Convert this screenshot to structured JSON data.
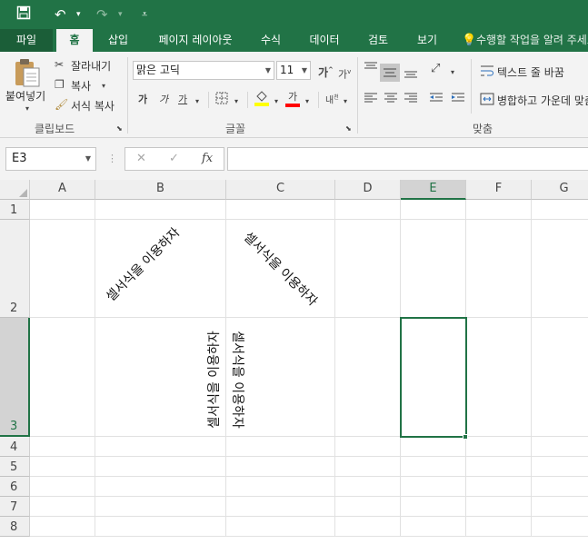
{
  "qat": {
    "save_icon": "save-icon",
    "undo_icon": "undo-icon",
    "redo_icon": "redo-icon",
    "customize_icon": "customize-icon"
  },
  "tabs": [
    {
      "label": "파일"
    },
    {
      "label": "홈"
    },
    {
      "label": "삽입"
    },
    {
      "label": "페이지 레이아웃"
    },
    {
      "label": "수식"
    },
    {
      "label": "데이터"
    },
    {
      "label": "검토"
    },
    {
      "label": "보기"
    }
  ],
  "tell_me": "수행할 작업을 알려 주세요",
  "clipboard": {
    "paste": "붙여넣기",
    "cut": "잘라내기",
    "copy": "복사",
    "format_painter": "서식 복사",
    "group_label": "클립보드"
  },
  "font": {
    "name": "맑은 고딕",
    "size": "11",
    "bold": "가",
    "italic": "가",
    "underline": "가",
    "font_color_char": "가",
    "group_label": "글꼴"
  },
  "alignment": {
    "wrap_text": "텍스트 줄 바꿈",
    "merge_center": "병합하고 가운데 맞춤",
    "group_label": "맞춤"
  },
  "formula_bar": {
    "name_box": "E3",
    "fx": "fx",
    "cancel": "✕",
    "enter": "✓",
    "value": ""
  },
  "columns": [
    "A",
    "B",
    "C",
    "D",
    "E",
    "F",
    "G"
  ],
  "rows": [
    "1",
    "2",
    "3",
    "4",
    "5",
    "6",
    "7",
    "8"
  ],
  "cells": {
    "b2": "셀서식을 이용하자",
    "c2": "셀서식을 이용하자",
    "b3": "셀서식을 이용하자",
    "c3": "셀서식을 이용하자"
  },
  "colors": {
    "accent": "#217346",
    "highlight": "#ffff00",
    "font_color": "#ff0000"
  }
}
